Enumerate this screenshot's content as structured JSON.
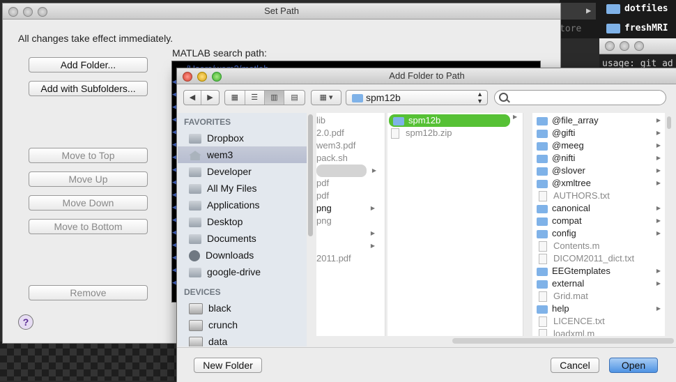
{
  "background": {
    "terminal_tab": "▶",
    "terminal_partial_text": "tore",
    "folders": [
      "dotfiles",
      "freshMRI"
    ],
    "terminal_usage": "usage: git ad"
  },
  "set_path": {
    "title": "Set Path",
    "message": "All changes take effect immediately.",
    "search_path_label": "MATLAB search path:",
    "first_path_partial": "/Users/wem3/matlab",
    "buttons": {
      "add_folder": "Add Folder...",
      "add_subfolders": "Add with Subfolders...",
      "move_top": "Move to Top",
      "move_up": "Move Up",
      "move_down": "Move Down",
      "move_bottom": "Move to Bottom",
      "remove": "Remove"
    },
    "help": "?"
  },
  "add_folder": {
    "title": "Add Folder to Path",
    "nav": {
      "back": "◀",
      "forward": "▶"
    },
    "view_modes": [
      "▦",
      "☰",
      "▥",
      "▤"
    ],
    "arrange": "▦ ▾",
    "location": "spm12b",
    "search_placeholder": "",
    "sidebar": {
      "favorites_header": "FAVORITES",
      "favorites": [
        "Dropbox",
        "wem3",
        "Developer",
        "All My Files",
        "Applications",
        "Desktop",
        "Documents",
        "Downloads",
        "google-drive"
      ],
      "devices_header": "DEVICES",
      "devices": [
        "black",
        "crunch",
        "data"
      ]
    },
    "col1": [
      "lib",
      "2.0.pdf",
      "wem3.pdf",
      "pack.sh",
      "",
      "pdf",
      "pdf",
      "png",
      "png",
      "",
      "",
      "2011.pdf"
    ],
    "col2": [
      "spm12b",
      "spm12b.zip"
    ],
    "col3": [
      {
        "name": "@file_array",
        "folder": true
      },
      {
        "name": "@gifti",
        "folder": true
      },
      {
        "name": "@meeg",
        "folder": true
      },
      {
        "name": "@nifti",
        "folder": true
      },
      {
        "name": "@slover",
        "folder": true
      },
      {
        "name": "@xmltree",
        "folder": true
      },
      {
        "name": "AUTHORS.txt",
        "folder": false
      },
      {
        "name": "canonical",
        "folder": true
      },
      {
        "name": "compat",
        "folder": true
      },
      {
        "name": "config",
        "folder": true
      },
      {
        "name": "Contents.m",
        "folder": false
      },
      {
        "name": "DICOM2011_dict.txt",
        "folder": false
      },
      {
        "name": "EEGtemplates",
        "folder": true
      },
      {
        "name": "external",
        "folder": true
      },
      {
        "name": "Grid.mat",
        "folder": false
      },
      {
        "name": "help",
        "folder": true
      },
      {
        "name": "LICENCE.txt",
        "folder": false
      },
      {
        "name": "loadxml.m",
        "folder": false
      }
    ],
    "buttons": {
      "new_folder": "New Folder",
      "cancel": "Cancel",
      "open": "Open"
    }
  },
  "colors": {
    "selection_green": "#56c135",
    "accent_blue": "#4f93e3"
  }
}
